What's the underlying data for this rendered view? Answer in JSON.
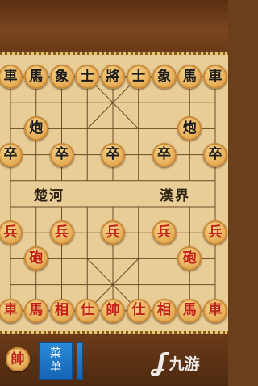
{
  "board": {
    "river_left": "楚河",
    "river_right": "漢界"
  },
  "pieces": [
    {
      "c": "black",
      "t": "車",
      "f": 0,
      "r": 0
    },
    {
      "c": "black",
      "t": "馬",
      "f": 1,
      "r": 0
    },
    {
      "c": "black",
      "t": "象",
      "f": 2,
      "r": 0
    },
    {
      "c": "black",
      "t": "士",
      "f": 3,
      "r": 0
    },
    {
      "c": "black",
      "t": "將",
      "f": 4,
      "r": 0
    },
    {
      "c": "black",
      "t": "士",
      "f": 5,
      "r": 0
    },
    {
      "c": "black",
      "t": "象",
      "f": 6,
      "r": 0
    },
    {
      "c": "black",
      "t": "馬",
      "f": 7,
      "r": 0
    },
    {
      "c": "black",
      "t": "車",
      "f": 8,
      "r": 0
    },
    {
      "c": "black",
      "t": "炮",
      "f": 1,
      "r": 2
    },
    {
      "c": "black",
      "t": "炮",
      "f": 7,
      "r": 2
    },
    {
      "c": "black",
      "t": "卒",
      "f": 0,
      "r": 3
    },
    {
      "c": "black",
      "t": "卒",
      "f": 2,
      "r": 3
    },
    {
      "c": "black",
      "t": "卒",
      "f": 4,
      "r": 3
    },
    {
      "c": "black",
      "t": "卒",
      "f": 6,
      "r": 3
    },
    {
      "c": "black",
      "t": "卒",
      "f": 8,
      "r": 3
    },
    {
      "c": "red",
      "t": "兵",
      "f": 0,
      "r": 6
    },
    {
      "c": "red",
      "t": "兵",
      "f": 2,
      "r": 6
    },
    {
      "c": "red",
      "t": "兵",
      "f": 4,
      "r": 6
    },
    {
      "c": "red",
      "t": "兵",
      "f": 6,
      "r": 6
    },
    {
      "c": "red",
      "t": "兵",
      "f": 8,
      "r": 6
    },
    {
      "c": "red",
      "t": "砲",
      "f": 1,
      "r": 7
    },
    {
      "c": "red",
      "t": "砲",
      "f": 7,
      "r": 7
    },
    {
      "c": "red",
      "t": "車",
      "f": 0,
      "r": 9
    },
    {
      "c": "red",
      "t": "馬",
      "f": 1,
      "r": 9
    },
    {
      "c": "red",
      "t": "相",
      "f": 2,
      "r": 9
    },
    {
      "c": "red",
      "t": "仕",
      "f": 3,
      "r": 9
    },
    {
      "c": "red",
      "t": "帥",
      "f": 4,
      "r": 9
    },
    {
      "c": "red",
      "t": "仕",
      "f": 5,
      "r": 9
    },
    {
      "c": "red",
      "t": "相",
      "f": 6,
      "r": 9
    },
    {
      "c": "red",
      "t": "馬",
      "f": 7,
      "r": 9
    },
    {
      "c": "red",
      "t": "車",
      "f": 8,
      "r": 9
    }
  ],
  "bottom_bar": {
    "turn_piece": "帥",
    "menu_label": "菜单",
    "watermark_text": "九游"
  },
  "colors": {
    "red_text": "#c2201b",
    "black_text": "#1b1b1b",
    "button_blue": "#1f78c8"
  }
}
